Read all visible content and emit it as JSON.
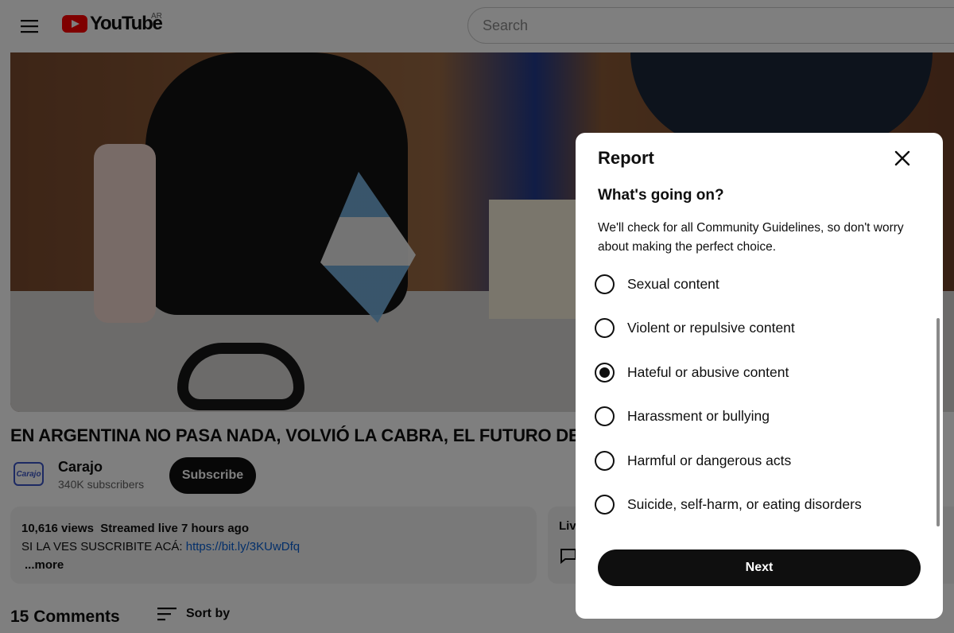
{
  "header": {
    "logo_text": "YouTube",
    "country_code": "AR",
    "search_placeholder": "Search"
  },
  "video": {
    "title": "EN ARGENTINA NO PASA NADA, VOLVIÓ LA CABRA, EL FUTURO DE V",
    "channel": {
      "avatar_text": "Carajo",
      "name": "Carajo",
      "subscribers": "340K subscribers",
      "subscribe_label": "Subscribe"
    },
    "description": {
      "views": "10,616 views",
      "streamed": "Streamed live 7 hours ago",
      "text": "SI LA VES SUSCRIBITE ACÁ: ",
      "link": "https://bit.ly/3KUwDfq",
      "more_label": "...more"
    },
    "live_card_label": "Liv"
  },
  "comments": {
    "count_label": "15 Comments",
    "sort_label": "Sort by"
  },
  "report_dialog": {
    "title": "Report",
    "question": "What's going on?",
    "notice": "We'll check for all Community Guidelines, so don't worry about making the perfect choice.",
    "options": [
      {
        "label": "Sexual content",
        "selected": false
      },
      {
        "label": "Violent or repulsive content",
        "selected": false
      },
      {
        "label": "Hateful or abusive content",
        "selected": true
      },
      {
        "label": "Harassment or bullying",
        "selected": false
      },
      {
        "label": "Harmful or dangerous acts",
        "selected": false
      },
      {
        "label": "Suicide, self-harm, or eating disorders",
        "selected": false
      }
    ],
    "next_label": "Next"
  },
  "colors": {
    "brand_red": "#ff0000",
    "link_blue": "#065fd4",
    "button_dark": "#0f0f0f",
    "overlay": "rgba(0,0,0,0.5)"
  }
}
